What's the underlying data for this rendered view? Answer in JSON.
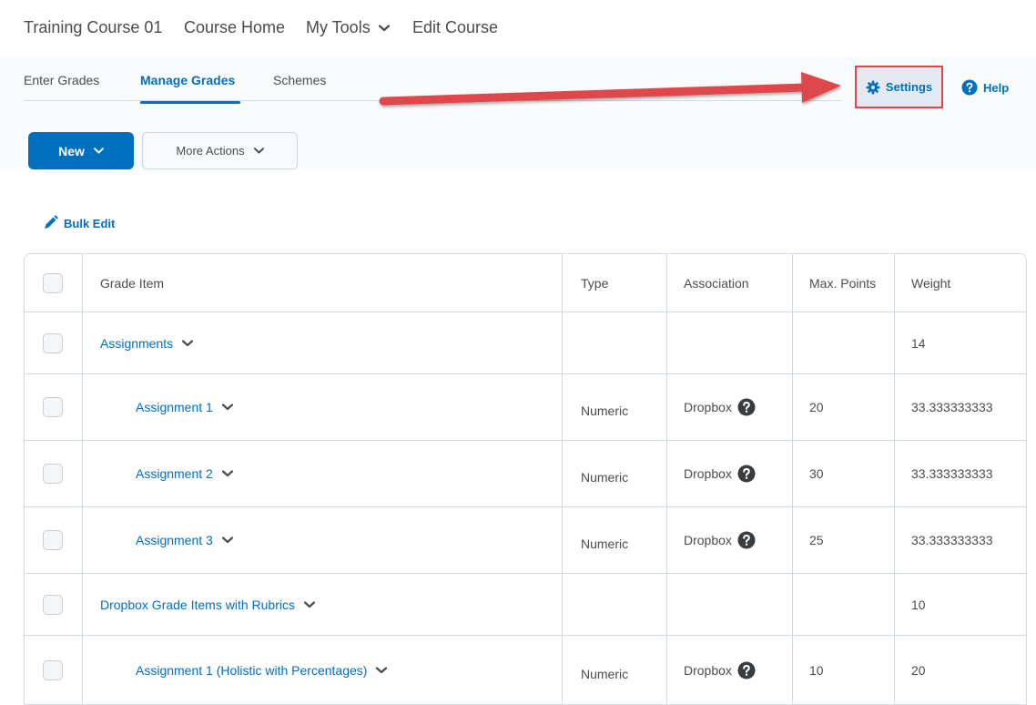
{
  "nav": {
    "course": "Training Course 01",
    "home": "Course Home",
    "tools": "My Tools",
    "edit": "Edit Course"
  },
  "tabs": [
    {
      "label": "Enter Grades"
    },
    {
      "label": "Manage Grades"
    },
    {
      "label": "Schemes"
    }
  ],
  "actions": {
    "settings": "Settings",
    "help": "Help",
    "new": "New",
    "more": "More Actions",
    "bulk_edit": "Bulk Edit"
  },
  "table": {
    "headers": [
      "Grade Item",
      "Type",
      "Association",
      "Max. Points",
      "Weight"
    ],
    "rows": [
      {
        "name": "Assignments",
        "type": "",
        "association": "",
        "max": "",
        "weight": "14"
      },
      {
        "name": "Assignment 1",
        "type": "Numeric",
        "association": "Dropbox",
        "max": "20",
        "weight": "33.333333333"
      },
      {
        "name": "Assignment 2",
        "type": "Numeric",
        "association": "Dropbox",
        "max": "30",
        "weight": "33.333333333"
      },
      {
        "name": "Assignment 3",
        "type": "Numeric",
        "association": "Dropbox",
        "max": "25",
        "weight": "33.333333333"
      },
      {
        "name": "Dropbox Grade Items with Rubrics",
        "type": "",
        "association": "",
        "max": "",
        "weight": "10"
      },
      {
        "name": "Assignment 1 (Holistic with Percentages)",
        "type": "Numeric",
        "association": "Dropbox",
        "max": "10",
        "weight": "20"
      }
    ]
  },
  "colors": {
    "accent": "#006fbf",
    "highlight_border": "#e0474c",
    "arrow": "#e0474c"
  }
}
